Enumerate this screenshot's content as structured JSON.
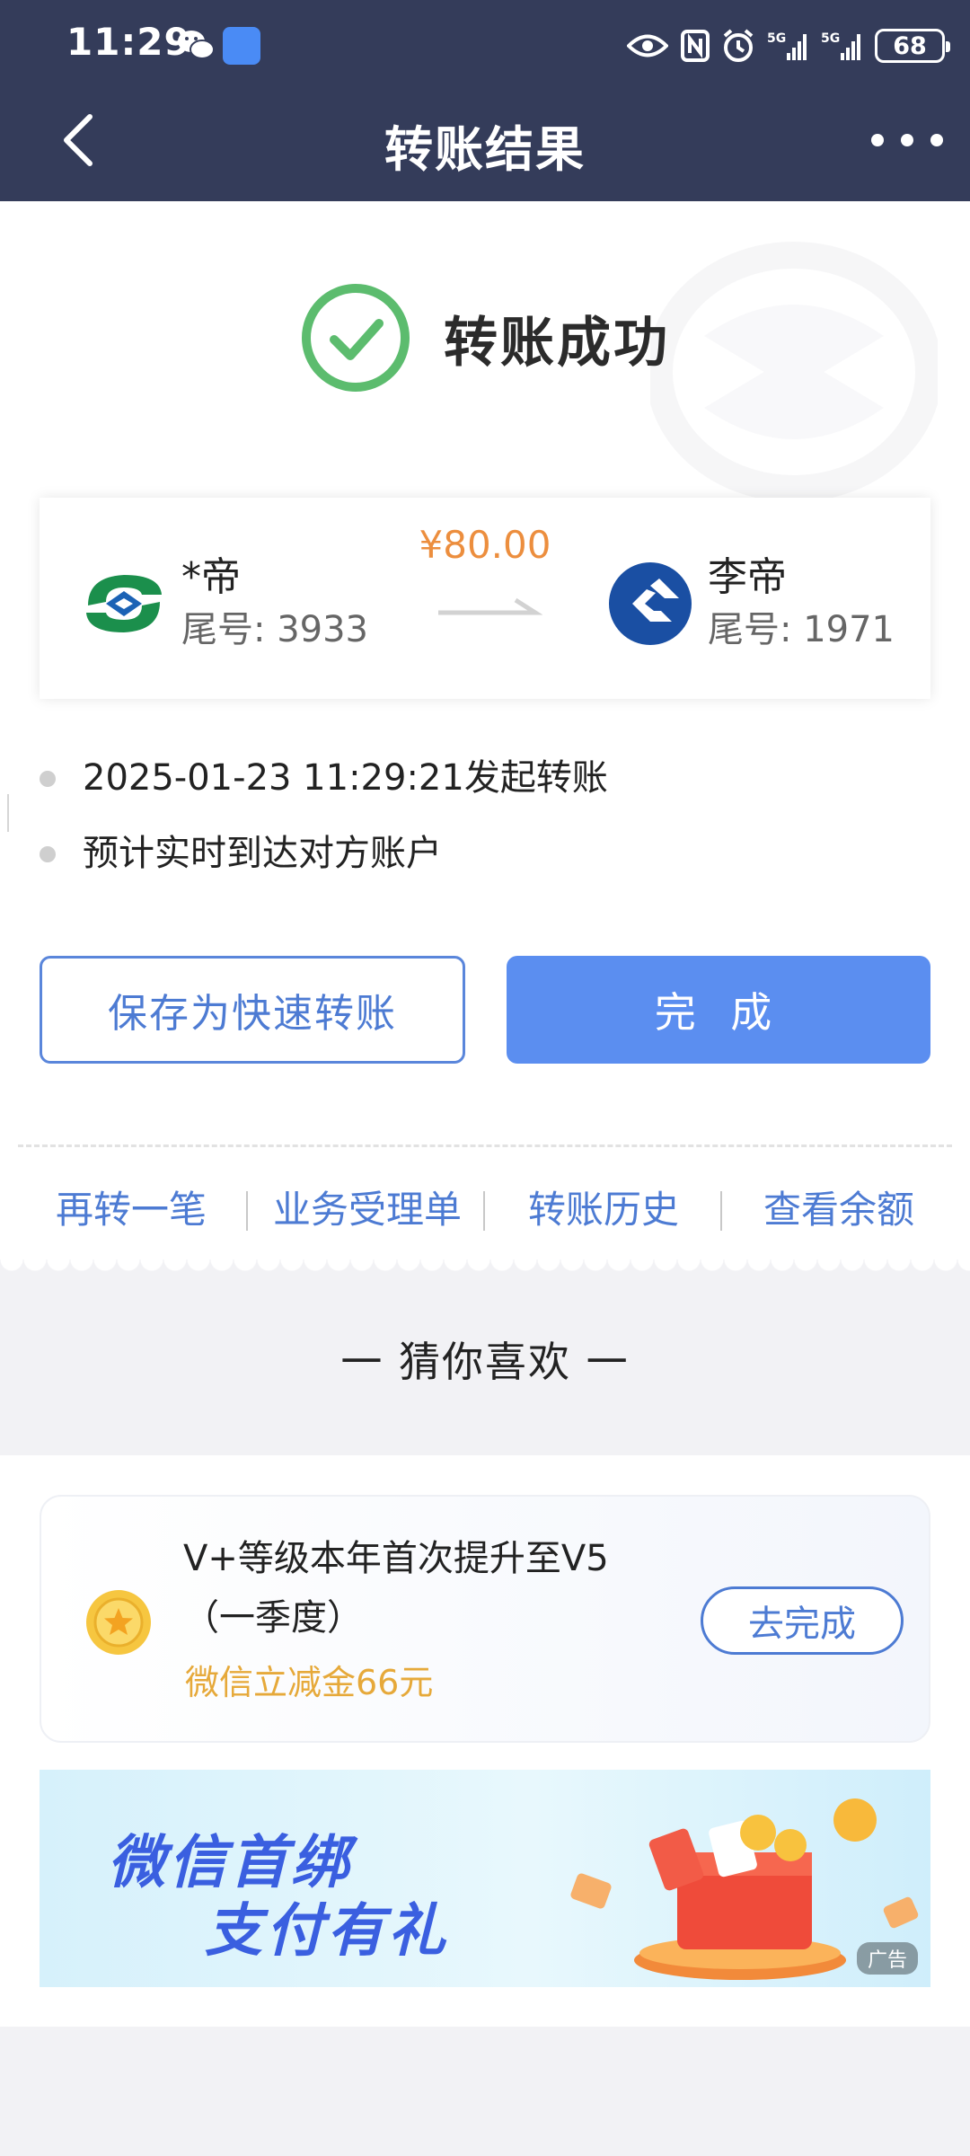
{
  "status_bar": {
    "time": "11:29",
    "battery": "68",
    "network_1": "5G",
    "network_2": "5G"
  },
  "header": {
    "title": "转账结果"
  },
  "result": {
    "status_text": "转账成功",
    "amount": "¥80.00",
    "from": {
      "name": "*帝",
      "tail": "尾号: 3933"
    },
    "to": {
      "name": "李帝",
      "tail": "尾号: 1971"
    },
    "timeline": [
      {
        "text": "2025-01-23 11:29:21发起转账"
      },
      {
        "text": "预计实时到达对方账户"
      }
    ],
    "save_button": "保存为快速转账",
    "done_button": "完 成"
  },
  "quick_links": [
    "再转一笔",
    "业务受理单",
    "转账历史",
    "查看余额"
  ],
  "recommend": {
    "heading": "一 猜你喜欢 一",
    "task": {
      "title": "V+等级本年首次提升至V5（一季度）",
      "bonus": "微信立减金66元",
      "button": "去完成"
    },
    "banner": {
      "line1": "微信首绑",
      "line2": "支付有礼",
      "ad_tag": "广告"
    }
  },
  "colors": {
    "header_bg": "#343c5a",
    "accent_blue": "#5b8ef0",
    "link_blue": "#4d7bd3",
    "success_green": "#5cbc6e",
    "amount_orange": "#ec8e3e",
    "bonus_gold": "#e6a93a"
  }
}
